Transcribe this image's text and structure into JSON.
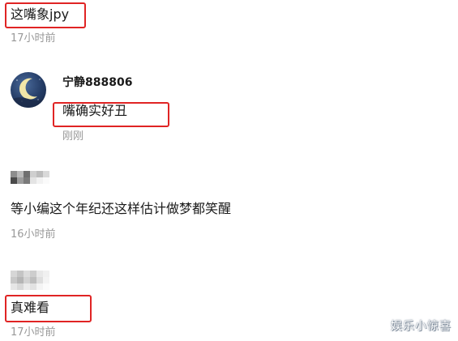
{
  "comments": [
    {
      "text": "这嘴象jpy",
      "time": "17小时前"
    },
    {
      "username": "宁静888806",
      "text": "嘴确实好丑",
      "time": "刚刚"
    },
    {
      "text": "等小编这个年纪还这样估计做梦都笑醒",
      "time": "16小时前"
    },
    {
      "text": "真难看",
      "time": "17小时前"
    }
  ],
  "colors": {
    "highlight_border": "#e02424",
    "timestamp": "#999999",
    "text": "#1a1a1a"
  },
  "icons": {
    "avatar": "crescent-moon-night-avatar"
  },
  "watermark": "娱乐小惊喜"
}
